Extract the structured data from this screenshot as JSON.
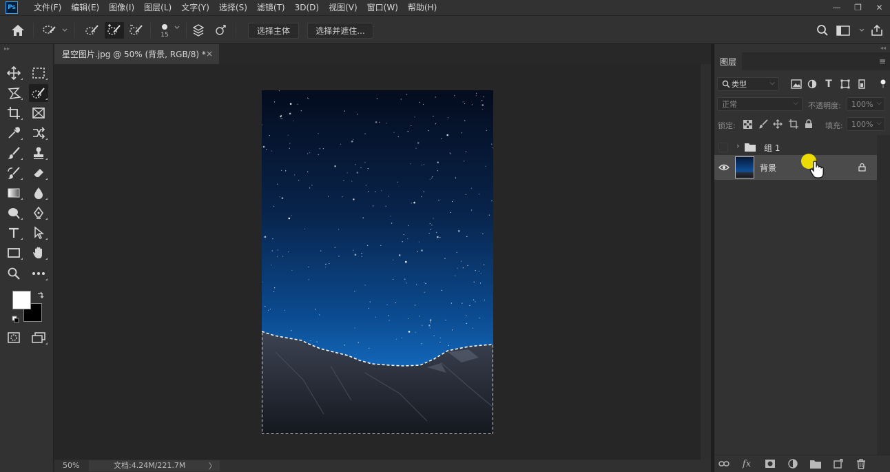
{
  "app": {
    "logo": "Ps"
  },
  "menu": [
    "文件(F)",
    "编辑(E)",
    "图像(I)",
    "图层(L)",
    "文字(Y)",
    "选择(S)",
    "滤镜(T)",
    "3D(D)",
    "视图(V)",
    "窗口(W)",
    "帮助(H)"
  ],
  "window_controls": {
    "minimize": "—",
    "restore": "❐",
    "close": "✕"
  },
  "options_bar": {
    "brush_size": "15",
    "select_subject": "选择主体",
    "select_and_mask": "选择并遮住..."
  },
  "document": {
    "tab_title": "星空图片.jpg @ 50% (背景, RGB/8) *",
    "close": "×",
    "zoom": "50%",
    "info": "文档:4.24M/221.7M",
    "info_arrow": "〉"
  },
  "panel": {
    "tab": "图层",
    "filter_kind": "类型",
    "blend_mode": "正常",
    "opacity_label": "不透明度:",
    "opacity_value": "100%",
    "lock_label": "锁定:",
    "fill_label": "填充:",
    "fill_value": "100%",
    "layers": [
      {
        "name": "组 1",
        "type": "group",
        "visible": false
      },
      {
        "name": "背景",
        "type": "image",
        "visible": true,
        "locked": true,
        "selected": true
      }
    ]
  },
  "colors": {
    "accent": "#31a8ff",
    "foreground": "#ffffff",
    "background": "#000000",
    "cursor_highlight": "#f5e300"
  }
}
